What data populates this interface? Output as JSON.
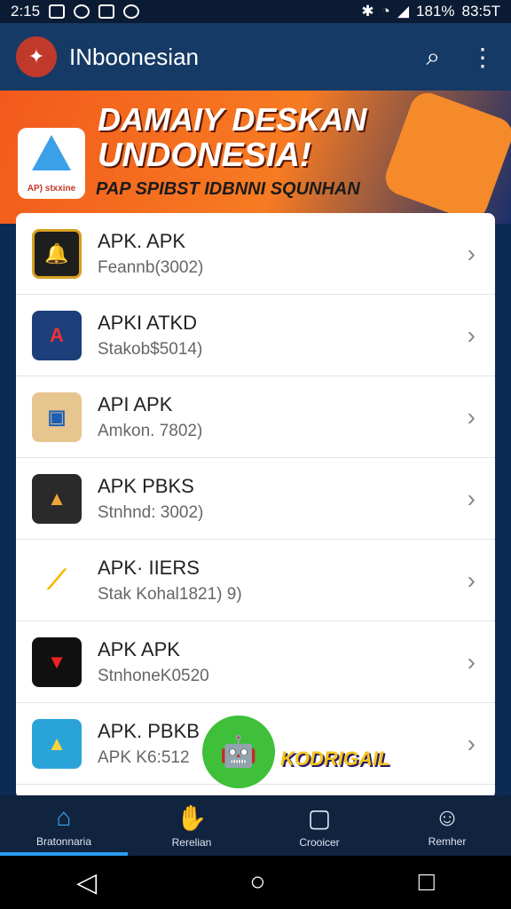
{
  "status_bar": {
    "time": "2:15",
    "battery": "181%",
    "clock_right": "83:5T"
  },
  "app_bar": {
    "title": "INboonesian",
    "icons": [
      "search-icon",
      "more-vert-icon"
    ]
  },
  "banner": {
    "line1": "DAMAIY DESKAN",
    "line2": "UNDONESIA!",
    "line3": "PAP SPIBST IDBNNI SQUNHAN",
    "badge": "AP) stxxine"
  },
  "list": [
    {
      "title": "APK. APK",
      "subtitle": "Feannb(3002)",
      "icon": "bell-icon",
      "color": "#1e1e1e"
    },
    {
      "title": "APKI ATKD",
      "subtitle": "Stakob$5014)",
      "icon": "a-logo-icon",
      "color": "#1c3f7a"
    },
    {
      "title": "API APK",
      "subtitle": "Amkon. 7802)",
      "icon": "store-icon",
      "color": "#e7c58f"
    },
    {
      "title": "APK PBKS",
      "subtitle": "Stnhnd: 3002)",
      "icon": "triangle-icon",
      "color": "#2a2a2a"
    },
    {
      "title": "APK· IIERS",
      "subtitle": "Stak Kohal1821)        9)",
      "icon": "stripes-icon",
      "color": "#ffffff"
    },
    {
      "title": "APK APK",
      "subtitle": "StnhoneK0520",
      "icon": "v-logo-icon",
      "color": "#111111"
    },
    {
      "title": "APK. PBKB",
      "subtitle": "APK K6:512",
      "icon": "a-triangle-icon",
      "color": "#2aa4d8"
    }
  ],
  "promo": {
    "label": "KODRIGAIL"
  },
  "bottom_nav": [
    {
      "label": "Bratonnaria",
      "icon": "home-icon",
      "active": true
    },
    {
      "label": "Rerelian",
      "icon": "hand-icon",
      "active": false
    },
    {
      "label": "Crooicer",
      "icon": "screen-icon",
      "active": false
    },
    {
      "label": "Remher",
      "icon": "user-icon",
      "active": false
    }
  ]
}
